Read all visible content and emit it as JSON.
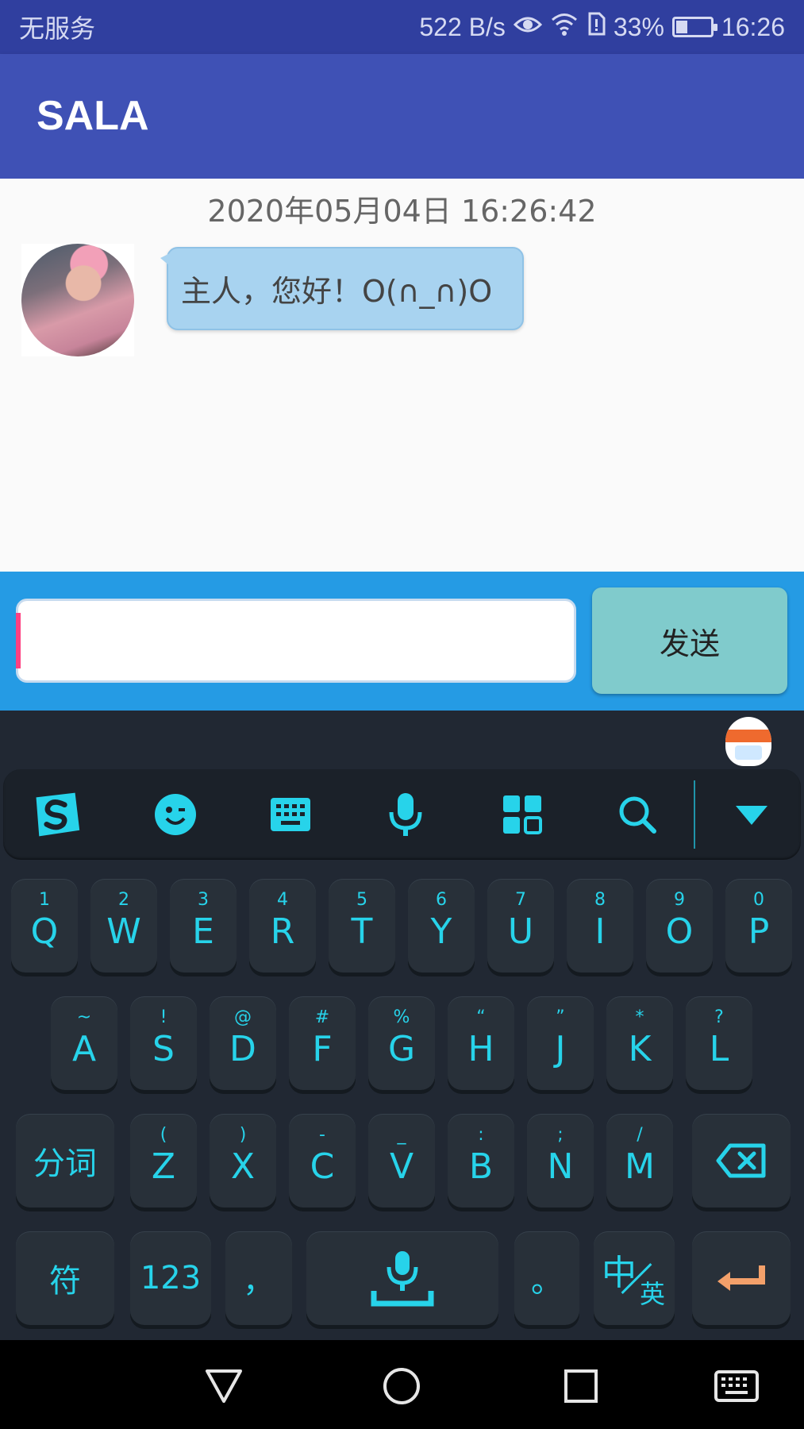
{
  "status_bar": {
    "carrier": "无服务",
    "speed": "522 B/s",
    "battery": "33%",
    "battery_level": 0.33,
    "time": "16:26"
  },
  "app_bar": {
    "title": "SALA"
  },
  "chat": {
    "timestamp": "2020年05月04日   16:26:42",
    "messages": [
      {
        "from": "bot",
        "text": "主人，您好！O(∩_∩)O"
      }
    ]
  },
  "input": {
    "value": "",
    "send_label": "发送"
  },
  "keyboard": {
    "toolbar_icons": [
      "sogou-logo-icon",
      "emoji-icon",
      "keyboard-icon",
      "microphone-icon",
      "apps-grid-icon",
      "search-icon",
      "collapse-keyboard-icon"
    ],
    "row1": [
      {
        "main": "Q",
        "sub": "1"
      },
      {
        "main": "W",
        "sub": "2"
      },
      {
        "main": "E",
        "sub": "3"
      },
      {
        "main": "R",
        "sub": "4"
      },
      {
        "main": "T",
        "sub": "5"
      },
      {
        "main": "Y",
        "sub": "6"
      },
      {
        "main": "U",
        "sub": "7"
      },
      {
        "main": "I",
        "sub": "8"
      },
      {
        "main": "O",
        "sub": "9"
      },
      {
        "main": "P",
        "sub": "0"
      }
    ],
    "row2": [
      {
        "main": "A",
        "sub": "~"
      },
      {
        "main": "S",
        "sub": "!"
      },
      {
        "main": "D",
        "sub": "@"
      },
      {
        "main": "F",
        "sub": "#"
      },
      {
        "main": "G",
        "sub": "%"
      },
      {
        "main": "H",
        "sub": "“"
      },
      {
        "main": "J",
        "sub": "”"
      },
      {
        "main": "K",
        "sub": "*"
      },
      {
        "main": "L",
        "sub": "?"
      }
    ],
    "row3": [
      {
        "main": "Z",
        "sub": "("
      },
      {
        "main": "X",
        "sub": ")"
      },
      {
        "main": "C",
        "sub": "-"
      },
      {
        "main": "V",
        "sub": "_"
      },
      {
        "main": "B",
        "sub": ":"
      },
      {
        "main": "N",
        "sub": ";"
      },
      {
        "main": "M",
        "sub": "/"
      }
    ],
    "fenci": "分词",
    "symbols": "符",
    "numbers": "123",
    "comma": "，",
    "period": "。",
    "lang_zh": "中",
    "lang_en": "英",
    "accent_color": "#27d3ea",
    "enter_color": "#f3a06a"
  },
  "nav_bar": {
    "icons": [
      "back-icon",
      "home-icon",
      "recents-icon",
      "keyboard-switch-icon"
    ]
  }
}
